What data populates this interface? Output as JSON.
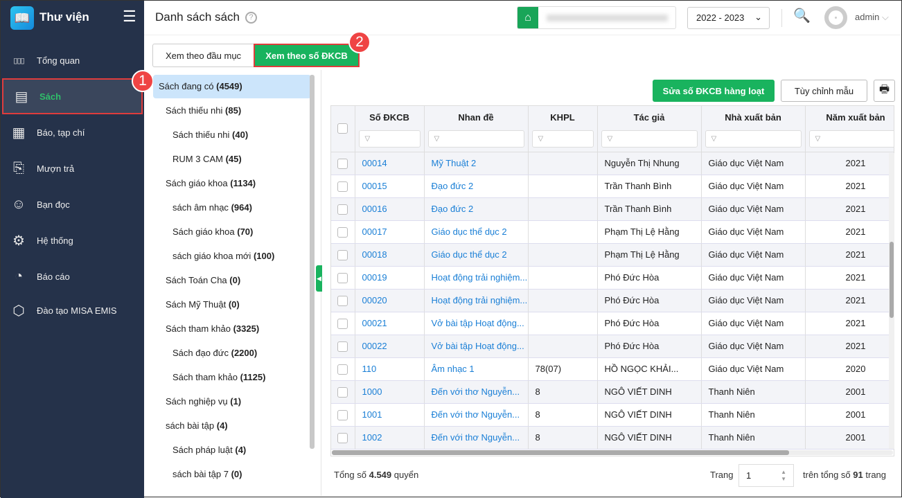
{
  "app": {
    "title": "Thư viện"
  },
  "sidebar": {
    "items": [
      {
        "label": "Tổng quan",
        "icon": "bar-chart-icon"
      },
      {
        "label": "Sách",
        "icon": "book-icon"
      },
      {
        "label": "Báo, tạp chí",
        "icon": "newspaper-icon"
      },
      {
        "label": "Mượn trả",
        "icon": "borrow-icon"
      },
      {
        "label": "Bạn đọc",
        "icon": "reader-icon"
      },
      {
        "label": "Hệ thống",
        "icon": "gear-icon"
      },
      {
        "label": "Báo cáo",
        "icon": "pie-chart-icon"
      },
      {
        "label": "Đào tạo MISA EMIS",
        "icon": "cube-icon"
      }
    ]
  },
  "header": {
    "title": "Danh sách sách",
    "year": "2022 - 2023",
    "user": "admin"
  },
  "annotations": [
    "1",
    "2"
  ],
  "tabs": [
    "Xem theo đầu mục",
    "Xem theo số ĐKCB"
  ],
  "tree": [
    {
      "label": "Sách đang có",
      "count": "(4549)",
      "level": 0
    },
    {
      "label": "Sách thiếu nhi",
      "count": "(85)",
      "level": 1
    },
    {
      "label": "Sách thiếu nhi",
      "count": "(40)",
      "level": 2
    },
    {
      "label": "RUM 3 CAM",
      "count": "(45)",
      "level": 2
    },
    {
      "label": "Sách giáo khoa",
      "count": "(1134)",
      "level": 1
    },
    {
      "label": "sách âm nhạc",
      "count": "(964)",
      "level": 2
    },
    {
      "label": "Sách giáo khoa",
      "count": "(70)",
      "level": 2
    },
    {
      "label": "sách giáo khoa mới",
      "count": "(100)",
      "level": 2
    },
    {
      "label": "Sách Toán Cha",
      "count": "(0)",
      "level": 1
    },
    {
      "label": "Sách Mỹ Thuật",
      "count": "(0)",
      "level": 1
    },
    {
      "label": "Sách tham khảo",
      "count": "(3325)",
      "level": 1
    },
    {
      "label": "Sách đạo đức",
      "count": "(2200)",
      "level": 2
    },
    {
      "label": "Sách tham khảo",
      "count": "(1125)",
      "level": 2
    },
    {
      "label": "Sách nghiệp vụ",
      "count": "(1)",
      "level": 1
    },
    {
      "label": "sách bài tập",
      "count": "(4)",
      "level": 1
    },
    {
      "label": "Sách pháp luật",
      "count": "(4)",
      "level": 2
    },
    {
      "label": "sách bài tập 7",
      "count": "(0)",
      "level": 2
    }
  ],
  "toolbar": {
    "bulk_edit": "Sửa số ĐKCB hàng loạt",
    "customize": "Tùy chỉnh mẫu"
  },
  "table": {
    "columns": [
      "Số ĐKCB",
      "Nhan đề",
      "KHPL",
      "Tác giả",
      "Nhà xuất bản",
      "Năm xuất bản"
    ],
    "rows": [
      [
        "00014",
        "Mỹ Thuật 2",
        "",
        "Nguyễn Thị Nhung",
        "Giáo dục Việt Nam",
        "2021"
      ],
      [
        "00015",
        "Đạo đức 2",
        "",
        "Trần Thanh Bình",
        "Giáo dục Việt Nam",
        "2021"
      ],
      [
        "00016",
        "Đạo đức 2",
        "",
        "Trần Thanh Bình",
        "Giáo dục Việt Nam",
        "2021"
      ],
      [
        "00017",
        "Giáo dục thể dục 2",
        "",
        "Phạm Thị Lệ Hằng",
        "Giáo dục Việt Nam",
        "2021"
      ],
      [
        "00018",
        "Giáo dục thể dục 2",
        "",
        "Phạm Thị Lệ Hằng",
        "Giáo dục Việt Nam",
        "2021"
      ],
      [
        "00019",
        "Hoạt động trải nghiệm...",
        "",
        "Phó Đức Hòa",
        "Giáo dục Việt Nam",
        "2021"
      ],
      [
        "00020",
        "Hoạt động trải nghiệm...",
        "",
        "Phó Đức Hòa",
        "Giáo dục Việt Nam",
        "2021"
      ],
      [
        "00021",
        "Vở bài tập Hoạt động...",
        "",
        "Phó Đức Hòa",
        "Giáo dục Việt Nam",
        "2021"
      ],
      [
        "00022",
        "Vở bài tập Hoạt động...",
        "",
        "Phó Đức Hòa",
        "Giáo dục Việt Nam",
        "2021"
      ],
      [
        "110",
        "Âm nhạc 1",
        "78(07)",
        "HỒ NGỌC KHẢI...",
        "Giáo dục Việt Nam",
        "2020"
      ],
      [
        "1000",
        "Đến với thơ Nguyễn...",
        "8",
        "NGÔ VIẾT DINH",
        "Thanh Niên",
        "2001"
      ],
      [
        "1001",
        "Đến với thơ Nguyễn...",
        "8",
        "NGÔ VIẾT DINH",
        "Thanh Niên",
        "2001"
      ],
      [
        "1002",
        "Đến với thơ Nguyễn...",
        "8",
        "NGÔ VIẾT DINH",
        "Thanh Niên",
        "2001"
      ]
    ]
  },
  "footer": {
    "total_prefix": "Tổng số",
    "total": "4.549",
    "total_suffix": "quyển",
    "page_label": "Trang",
    "page": "1",
    "pages_prefix": "trên tổng số",
    "pages": "91",
    "pages_suffix": "trang"
  }
}
